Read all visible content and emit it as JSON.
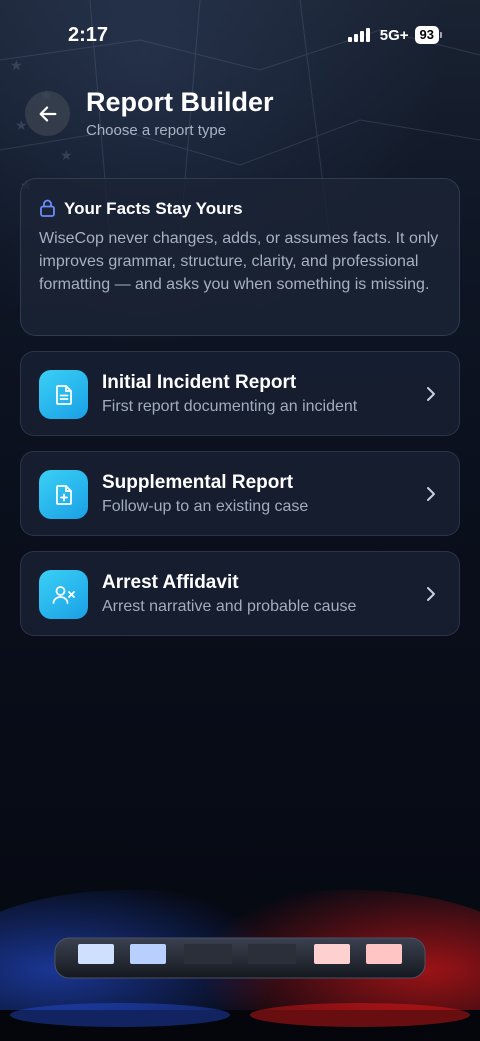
{
  "status_bar": {
    "time": "2:17",
    "network": "5G+",
    "battery": "93"
  },
  "header": {
    "back_icon": "arrow-left-icon",
    "title": "Report Builder",
    "subtitle": "Choose a report type"
  },
  "info_card": {
    "icon": "lock-icon",
    "title": "Your Facts Stay Yours",
    "body": "WiseCop never changes, adds, or assumes facts. It only improves grammar, structure, clarity, and professional formatting — and asks you when something is missing."
  },
  "report_types": [
    {
      "icon": "document-icon",
      "title": "Initial Incident Report",
      "subtitle": "First report documenting an incident"
    },
    {
      "icon": "document-plus-icon",
      "title": "Supplemental Report",
      "subtitle": "Follow-up to an existing case"
    },
    {
      "icon": "user-x-icon",
      "title": "Arrest Affidavit",
      "subtitle": "Arrest narrative and probable cause"
    }
  ],
  "colors": {
    "background": "#0a0f1c",
    "card": "#181f32",
    "accent": "#2bb8ee",
    "lock_accent": "#6b8cff",
    "light_blue": "#3d7dff",
    "light_red": "#ff2a2a"
  }
}
